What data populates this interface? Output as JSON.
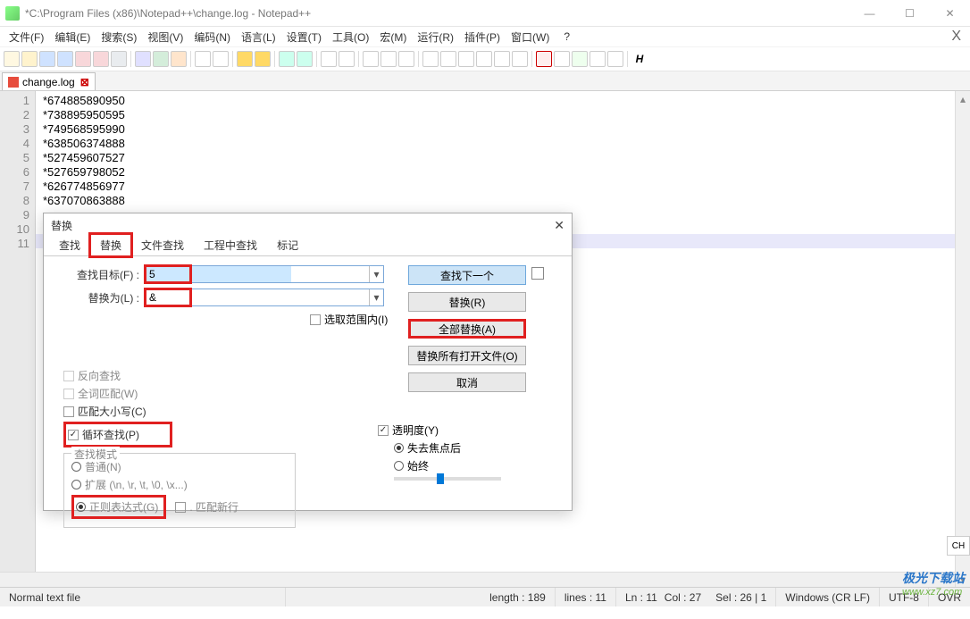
{
  "titlebar": {
    "text": "*C:\\Program Files (x86)\\Notepad++\\change.log - Notepad++"
  },
  "menubar": {
    "items": [
      "文件(F)",
      "编辑(E)",
      "搜索(S)",
      "视图(V)",
      "编码(N)",
      "语言(L)",
      "设置(T)",
      "工具(O)",
      "宏(M)",
      "运行(R)",
      "插件(P)",
      "窗口(W)"
    ],
    "qmark": "?",
    "x": "X"
  },
  "tab": {
    "name": "change.log"
  },
  "code": {
    "lines": [
      "*674885890950",
      "*738895950595",
      "*749568595990",
      "*638506374888",
      "*527459607527",
      "*527659798052",
      "*626774856977",
      "*637070863888",
      "",
      "",
      ""
    ]
  },
  "dialog": {
    "title": "替换",
    "tabs": [
      "查找",
      "替换",
      "文件查找",
      "工程中查找",
      "标记"
    ],
    "active_tab": 1,
    "find_label": "查找目标(F) :",
    "find_value": "5",
    "replace_label": "替换为(L) :",
    "replace_value": "&",
    "btn_find_next": "查找下一个",
    "btn_replace": "替换(R)",
    "btn_replace_all": "全部替换(A)",
    "btn_replace_all_open": "替换所有打开文件(O)",
    "btn_cancel": "取消",
    "selection_only": "选取范围内(I)",
    "chk_backward": "反向查找",
    "chk_whole_word": "全词匹配(W)",
    "chk_match_case": "匹配大小写(C)",
    "chk_wrap": "循环查找(P)",
    "group_search_mode": "查找模式",
    "radio_normal": "普通(N)",
    "radio_extended": "扩展 (\\n, \\r, \\t, \\0, \\x...)",
    "radio_regex": "正则表达式(G)",
    "chk_dot_nl": ". 匹配新行",
    "chk_transparency": "透明度(Y)",
    "radio_lose_focus": "失去焦点后",
    "radio_always": "始终"
  },
  "statusbar": {
    "filetype": "Normal text file",
    "length": "length : 189",
    "lines": "lines : 11",
    "ln": "Ln : 11",
    "col": "Col : 27",
    "sel": "Sel : 26 | 1",
    "eol": "Windows (CR LF)",
    "encoding": "UTF-8",
    "ovr": "OVR"
  },
  "watermark": {
    "cn": "极光下载站",
    "en": "www.xz7.com"
  },
  "badge": "CH"
}
